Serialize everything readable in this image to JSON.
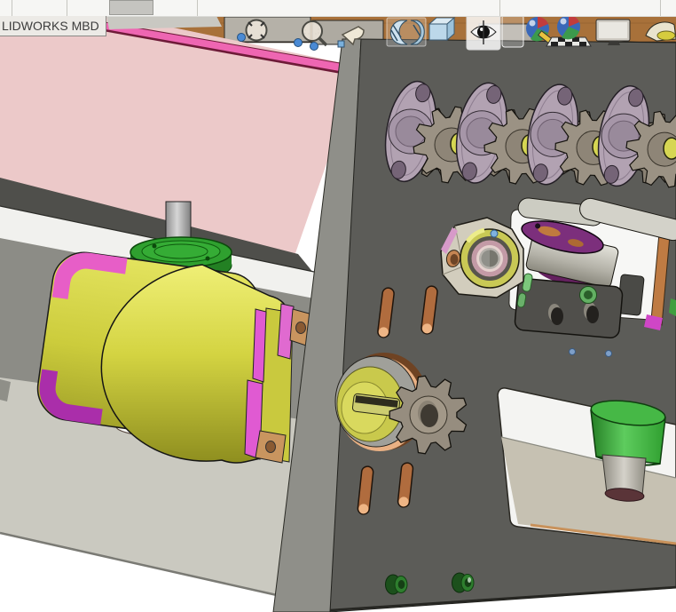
{
  "app_bar": {
    "tab_label": "LIDWORKS MBD"
  },
  "heads_up_toolbar": {
    "tools": [
      {
        "name": "zoom-to-fit",
        "icon": "magnifier-arrows-icon"
      },
      {
        "name": "zoom-to-area",
        "icon": "magnifier-region-icon"
      },
      {
        "name": "previous-view",
        "icon": "back-arrow-icon"
      },
      {
        "name": "section-view",
        "icon": "hatched-cut-cube-icon"
      },
      {
        "name": "display-style",
        "icon": "glass-cube-icon"
      },
      {
        "name": "hide-show-items",
        "icon": "eye-icon",
        "state": "highlighted"
      },
      {
        "name": "view-orientation",
        "icon": "empty-frame-icon"
      },
      {
        "name": "edit-appearance",
        "icon": "color-sphere-pencil-icon"
      },
      {
        "name": "apply-scene",
        "icon": "sphere-checkered-floor-icon"
      },
      {
        "name": "view-settings",
        "icon": "monitor-icon"
      }
    ]
  },
  "viewport": {
    "scene": "3D CAD assembly view",
    "model_parts": [
      {
        "name": "wood-rail",
        "color": "#a8713a"
      },
      {
        "name": "pink-guard-panel",
        "color": "#ecc9c9",
        "edge_color": "#ee66b2"
      },
      {
        "name": "main-plate",
        "color": "#5c5c58"
      },
      {
        "name": "chain-sprocket-row",
        "colors": [
          "#b2a2b2",
          "#9b9284",
          "#d6d653"
        ],
        "units": 4
      },
      {
        "name": "gear-motor",
        "colors": [
          "#d2d240",
          "#e75ec7",
          "#aa2eaa"
        ]
      },
      {
        "name": "motor-flange",
        "color": "#2fa02f"
      },
      {
        "name": "base-plate",
        "color": "#cac9c0"
      },
      {
        "name": "adjustment-slots",
        "color": "#b06c3e",
        "count": 4
      },
      {
        "name": "drive-sprocket",
        "color": "#968d7f"
      },
      {
        "name": "shaft-hub",
        "color": "#d9d95e"
      },
      {
        "name": "pillow-block-bearing",
        "colors": [
          "#c9c955",
          "#c39aa6"
        ]
      },
      {
        "name": "cam-disc",
        "color": "#7c2f7c"
      },
      {
        "name": "clamp-block",
        "color": "#504f4b"
      },
      {
        "name": "green-roller",
        "color": "#3cae3c"
      },
      {
        "name": "green-screws",
        "color": "#2e7e2e",
        "count": 2
      },
      {
        "name": "blue-dowel-dots",
        "color": "#7e9fc8",
        "count": 2
      }
    ]
  }
}
